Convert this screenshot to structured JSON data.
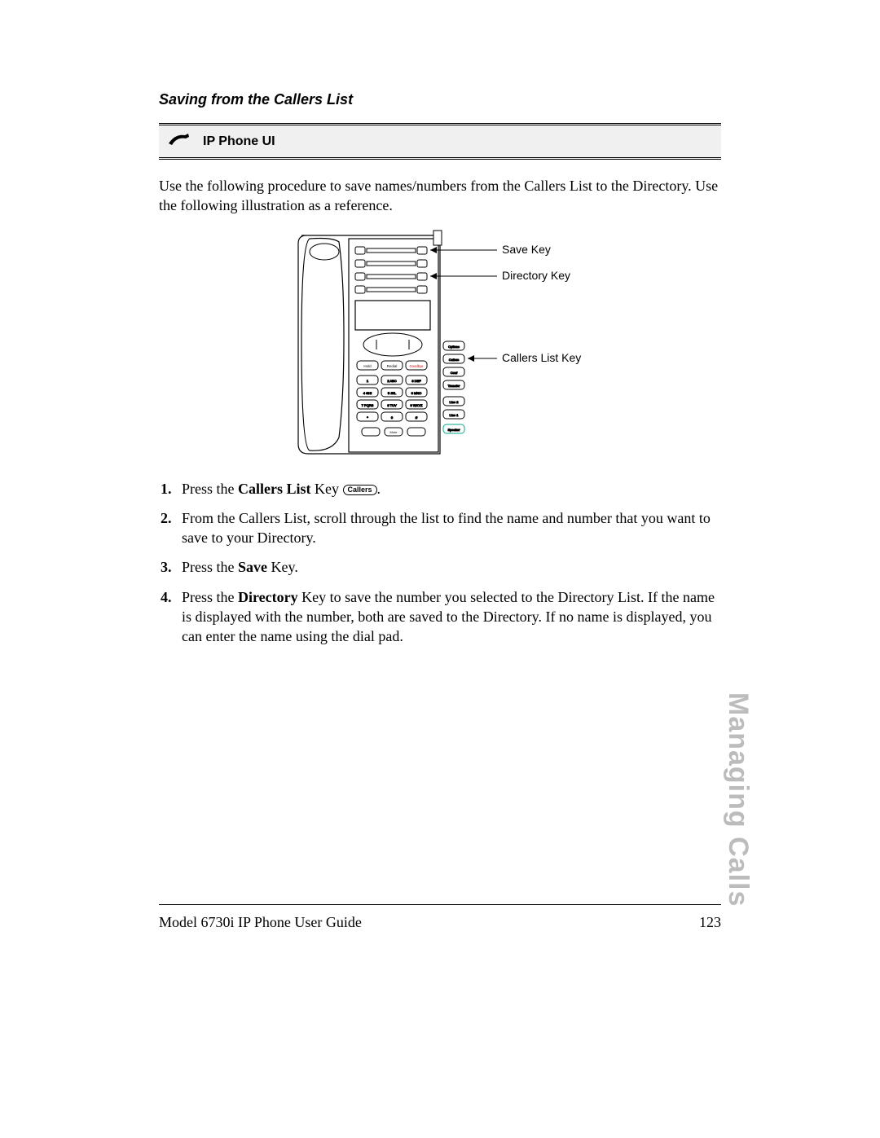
{
  "section_title": "Saving from the Callers List",
  "callout": {
    "label": "IP Phone UI"
  },
  "intro": "Use the following procedure to save names/numbers from the Callers List to the Directory. Use the following illustration as a reference.",
  "figure": {
    "labels": {
      "save_key": "Save Key",
      "directory_key": "Directory Key",
      "callers_list_key": "Callers List Key"
    },
    "buttons": {
      "options": "Options",
      "callers": "Callers",
      "conf": "Conf",
      "transfer": "Transfer",
      "line2": "Line 2",
      "line1": "Line 1",
      "speaker": "Speaker",
      "hold": "Hold",
      "redial": "Redial",
      "goodbye": "Goodbye",
      "mute": "Mute"
    },
    "keypad": [
      "1",
      "2 ABC",
      "3 DEF",
      "4 GHI",
      "5 JKL",
      "6 MNO",
      "7 PQRS",
      "8 TUV",
      "9 WXYZ",
      "*",
      "0",
      "#"
    ]
  },
  "steps": [
    {
      "num": "1.",
      "prefix": "Press the ",
      "bold": "Callers List",
      "suffix": " Key ",
      "after_icon": ".",
      "icon_label": "Callers"
    },
    {
      "num": "2.",
      "text": "From the Callers List, scroll through the list to find the name and number that you want to save to your Directory."
    },
    {
      "num": "3.",
      "prefix": "Press the ",
      "bold": "Save",
      "suffix": " Key."
    },
    {
      "num": "4.",
      "prefix": "Press the ",
      "bold": "Directory",
      "suffix": " Key to save the number you selected to the Directory List. If the name is displayed with the number, both are saved to the Directory. If no name is displayed, you can enter the name using the dial pad."
    }
  ],
  "side_tab": "Managing Calls",
  "footer": {
    "left": "Model 6730i IP Phone User Guide",
    "page": "123"
  }
}
